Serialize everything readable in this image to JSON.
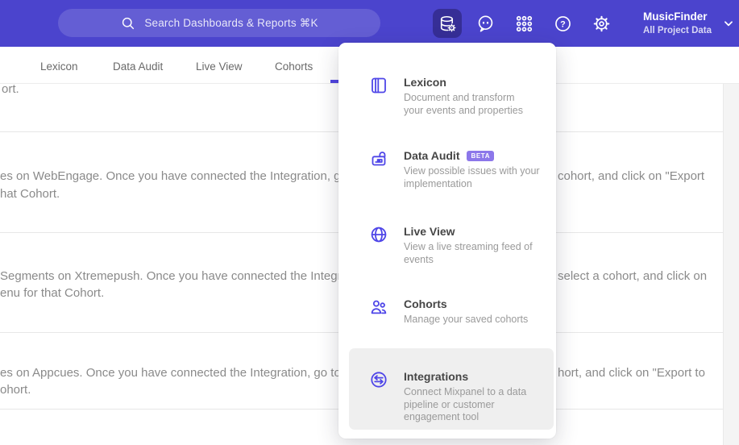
{
  "topbar": {
    "search": {
      "placeholder": "Search Dashboards & Reports ⌘K"
    },
    "project": {
      "name": "MusicFinder",
      "scope": "All Project Data"
    },
    "icons": [
      "database-gear",
      "chat-face",
      "apps-grid",
      "help-question",
      "settings-gear"
    ]
  },
  "tabs": {
    "items": [
      {
        "label": "Lexicon"
      },
      {
        "label": "Data Audit"
      },
      {
        "label": "Live View"
      },
      {
        "label": "Cohorts"
      }
    ],
    "active_indicator_color": "#4f44e0"
  },
  "menu": {
    "items": [
      {
        "title": "Lexicon",
        "icon": "lexicon-book-icon",
        "desc": [
          "Document and transform",
          "your events and properties"
        ]
      },
      {
        "title": "Data Audit",
        "badge": "BETA",
        "icon": "data-audit-lock-icon",
        "desc": [
          "View possible issues with your",
          "implementation"
        ]
      },
      {
        "title": "Live View",
        "icon": "live-view-globe-icon",
        "desc": [
          "View a live streaming feed of",
          "events"
        ]
      },
      {
        "title": "Cohorts",
        "icon": "cohorts-people-icon",
        "desc": [
          "Manage your saved cohorts"
        ]
      },
      {
        "title": "Integrations",
        "icon": "integrations-sync-icon",
        "highlighted": true,
        "desc": [
          "Connect Mixpanel to a data",
          "pipeline or customer",
          "engagement tool"
        ]
      }
    ]
  },
  "background": {
    "lines": [
      {
        "text": "ort."
      },
      {
        "text": "es on WebEngage. Once you have connected the Integration, go to the"
      },
      {
        "text": "cohort, and click on \"Export"
      },
      {
        "text": "hat Cohort."
      },
      {
        "text": "Segments on Xtremepush. Once you have connected the Integration, "
      },
      {
        "text": "select a cohort, and click on"
      },
      {
        "text": "enu for that Cohort."
      },
      {
        "text": "es on Appcues. Once you have connected the Integration, go to the M"
      },
      {
        "text": "hort, and click on \"Export to"
      },
      {
        "text": "ohort."
      }
    ]
  },
  "colors": {
    "topbar": "#4b44cd",
    "accent": "#4f44e0",
    "menu_icon": "#4f46e8",
    "beta_badge": "#8c77ea",
    "highlight_row": "#efefef"
  }
}
